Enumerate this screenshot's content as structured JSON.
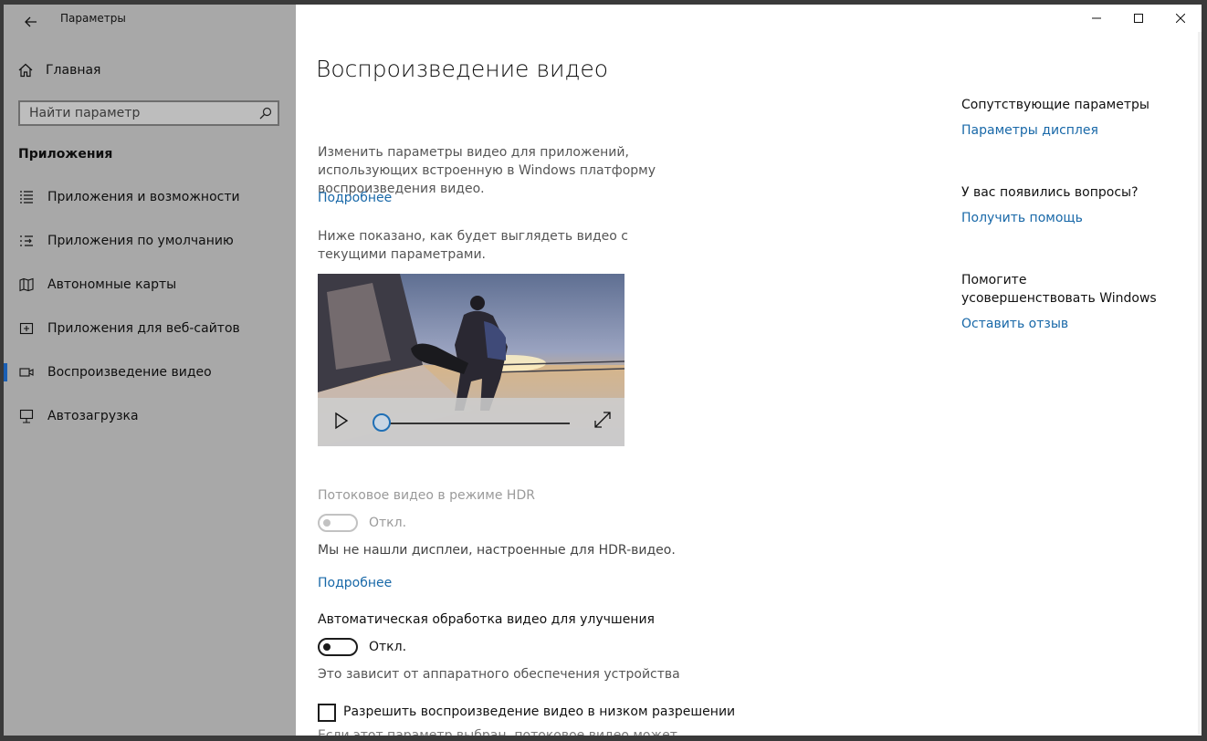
{
  "app": {
    "title": "Параметры"
  },
  "sidebar": {
    "home_label": "Главная",
    "search_placeholder": "Найти параметр",
    "section_title": "Приложения",
    "items": [
      {
        "label": "Приложения и возможности",
        "icon": "apps-features-icon"
      },
      {
        "label": "Приложения по умолчанию",
        "icon": "default-apps-icon"
      },
      {
        "label": "Автономные карты",
        "icon": "offline-maps-icon"
      },
      {
        "label": "Приложения для веб-сайтов",
        "icon": "apps-for-websites-icon"
      },
      {
        "label": "Воспроизведение видео",
        "icon": "video-playback-icon",
        "active": true
      },
      {
        "label": "Автозагрузка",
        "icon": "startup-icon"
      }
    ]
  },
  "main": {
    "title": "Воспроизведение видео",
    "intro": "Изменить параметры видео для приложений, использующих встроенную в Windows платформу воспроизведения видео.",
    "learn_more_1": "Подробнее",
    "preview_caption": "Ниже показано, как будет выглядеть видео с текущими параметрами.",
    "hdr": {
      "label": "Потоковое видео в режиме HDR",
      "state": "Откл.",
      "note": "Мы не нашли дисплеи, настроенные для HDR-видео.",
      "learn_more": "Подробнее"
    },
    "auto_process": {
      "label": "Автоматическая обработка видео для улучшения",
      "state": "Откл.",
      "note": "Это зависит от аппаратного обеспечения устройства"
    },
    "low_res": {
      "label": "Разрешить воспроизведение видео в низком разрешении",
      "note_partial": "Если этот параметр выбран, потоковое видео может"
    }
  },
  "related": {
    "heading": "Сопутствующие параметры",
    "display_link": "Параметры дисплея",
    "questions_heading": "У вас появились вопросы?",
    "help_link": "Получить помощь",
    "improve_heading": "Помогите усовершенствовать Windows",
    "feedback_link": "Оставить отзыв"
  },
  "colors": {
    "sidebar_bg": "#a8a8a8",
    "accent": "#1868a8",
    "active_marker": "#1a5fb4"
  }
}
